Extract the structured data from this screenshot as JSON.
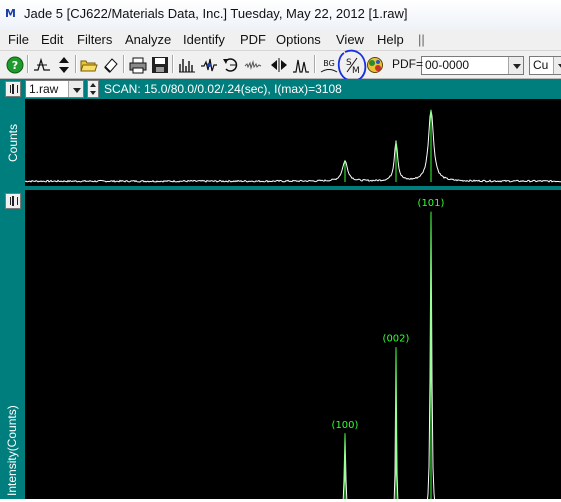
{
  "window": {
    "title": "Jade 5 [CJ622/Materials Data, Inc.] Tuesday, May 22, 2012 [1.raw]",
    "app_icon_text": "M"
  },
  "menu": {
    "items": [
      "File",
      "Edit",
      "Filters",
      "Analyze",
      "Identify",
      "PDF",
      "Options",
      "View",
      "Help"
    ],
    "grip": "||"
  },
  "toolbar": {
    "buttons": [
      "help-icon",
      "peak-marker-icon",
      "up-down-icon",
      "open-folder-icon",
      "eraser-icon",
      "print-icon",
      "save-icon",
      "peak-list-icon",
      "smooth-icon",
      "rotate-icon",
      "noise-icon",
      "arrows-icon",
      "peak-profile-icon",
      "background-icon",
      "strip-k-alpha2-icon",
      "globe-icon"
    ],
    "bg_label": "BG",
    "pdf_label": "PDF=",
    "pdf_value": "00-0000",
    "element_value": "Cu"
  },
  "scan": {
    "file_value": "1.raw",
    "info": "SCAN: 15.0/80.0/0.02/.24(sec), I(max)=3108"
  },
  "panels": {
    "overview_ylabel": "Counts",
    "main_ylabel": "Intensity(Counts)"
  },
  "colors": {
    "teal": "#007d7d",
    "trace": "#ffffff",
    "marker": "#33ff33",
    "annotation": "#1a2fe0"
  },
  "chart_data": {
    "type": "line",
    "series": [
      {
        "peaks": [
          {
            "label": "(100)",
            "relative_intensity": 0.28
          },
          {
            "label": "(002)",
            "relative_intensity": 0.56
          },
          {
            "label": "(101)",
            "relative_intensity": 1.0
          }
        ]
      }
    ],
    "peak_labels": [
      "(100)",
      "(002)",
      "(101)"
    ]
  }
}
